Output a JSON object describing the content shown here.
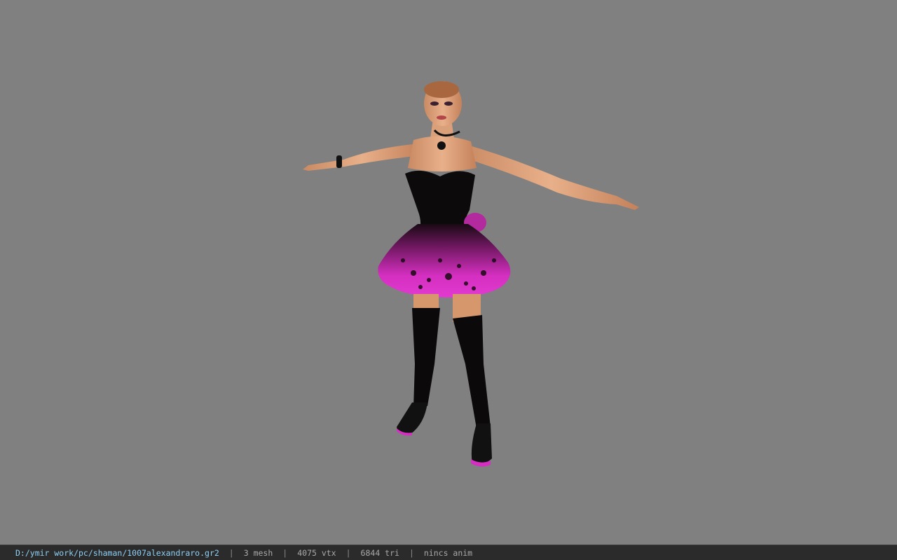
{
  "viewer": {
    "background_color": "#808080",
    "model_subject": "female character model in t-pose"
  },
  "status_bar": {
    "file_path": "D:/ymir work/pc/shaman/1007alexandraro.gr2",
    "separator": "|",
    "mesh_count": "3 mesh",
    "vertex_count": "4075 vtx",
    "triangle_count": "6844 tri",
    "animation": "nincs anim",
    "path_color": "#8fd0f4"
  }
}
